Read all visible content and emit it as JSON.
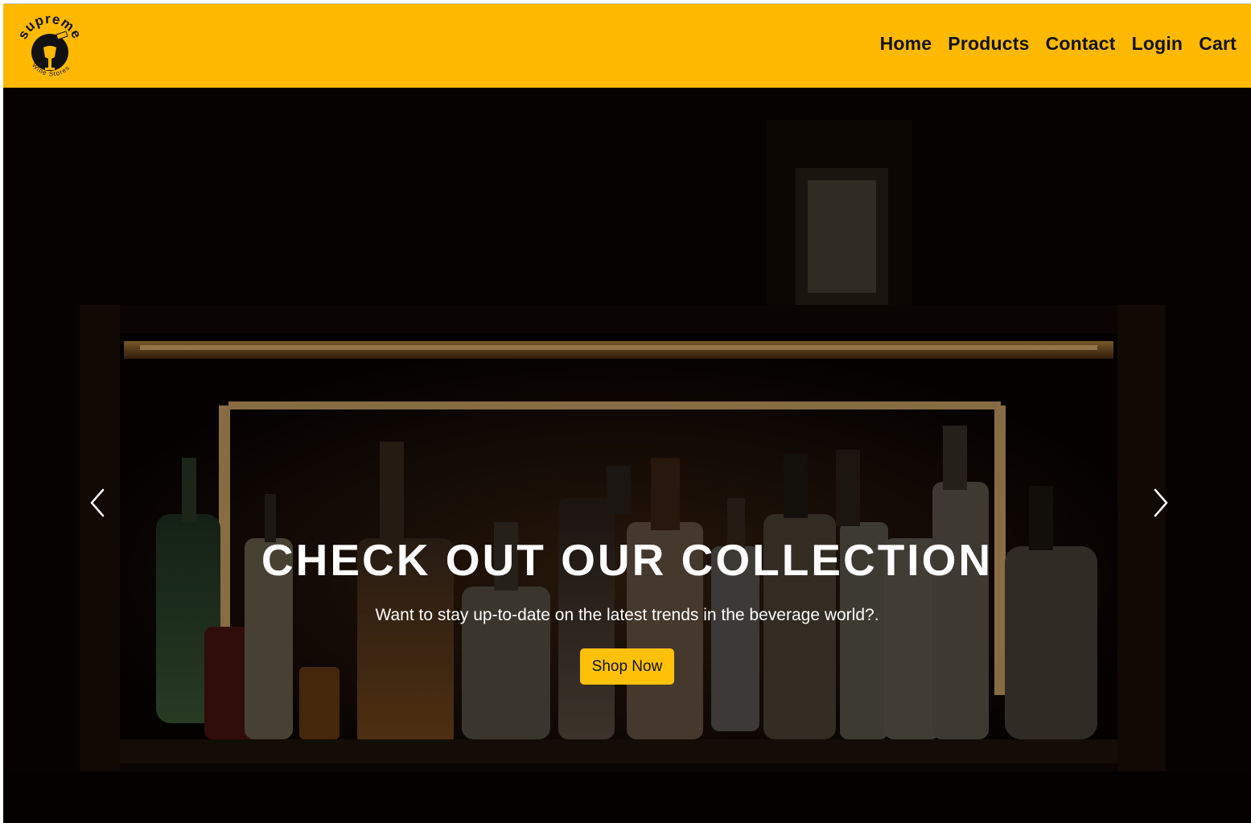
{
  "brand": {
    "logo_top_text": "supreme",
    "logo_bottom_text": "Wine Stores",
    "nav_color": "#FFB900"
  },
  "nav": {
    "items": [
      {
        "label": "Home"
      },
      {
        "label": "Products"
      },
      {
        "label": "Contact"
      },
      {
        "label": "Login"
      },
      {
        "label": "Cart"
      }
    ]
  },
  "hero": {
    "title": "CHECK OUT OUR COLLECTION",
    "subtitle": "Want to stay up-to-date on the latest trends in the beverage world?.",
    "button_label": "Shop Now",
    "button_color": "#FFC107",
    "prev_icon": "chevron-left-icon",
    "next_icon": "chevron-right-icon"
  }
}
